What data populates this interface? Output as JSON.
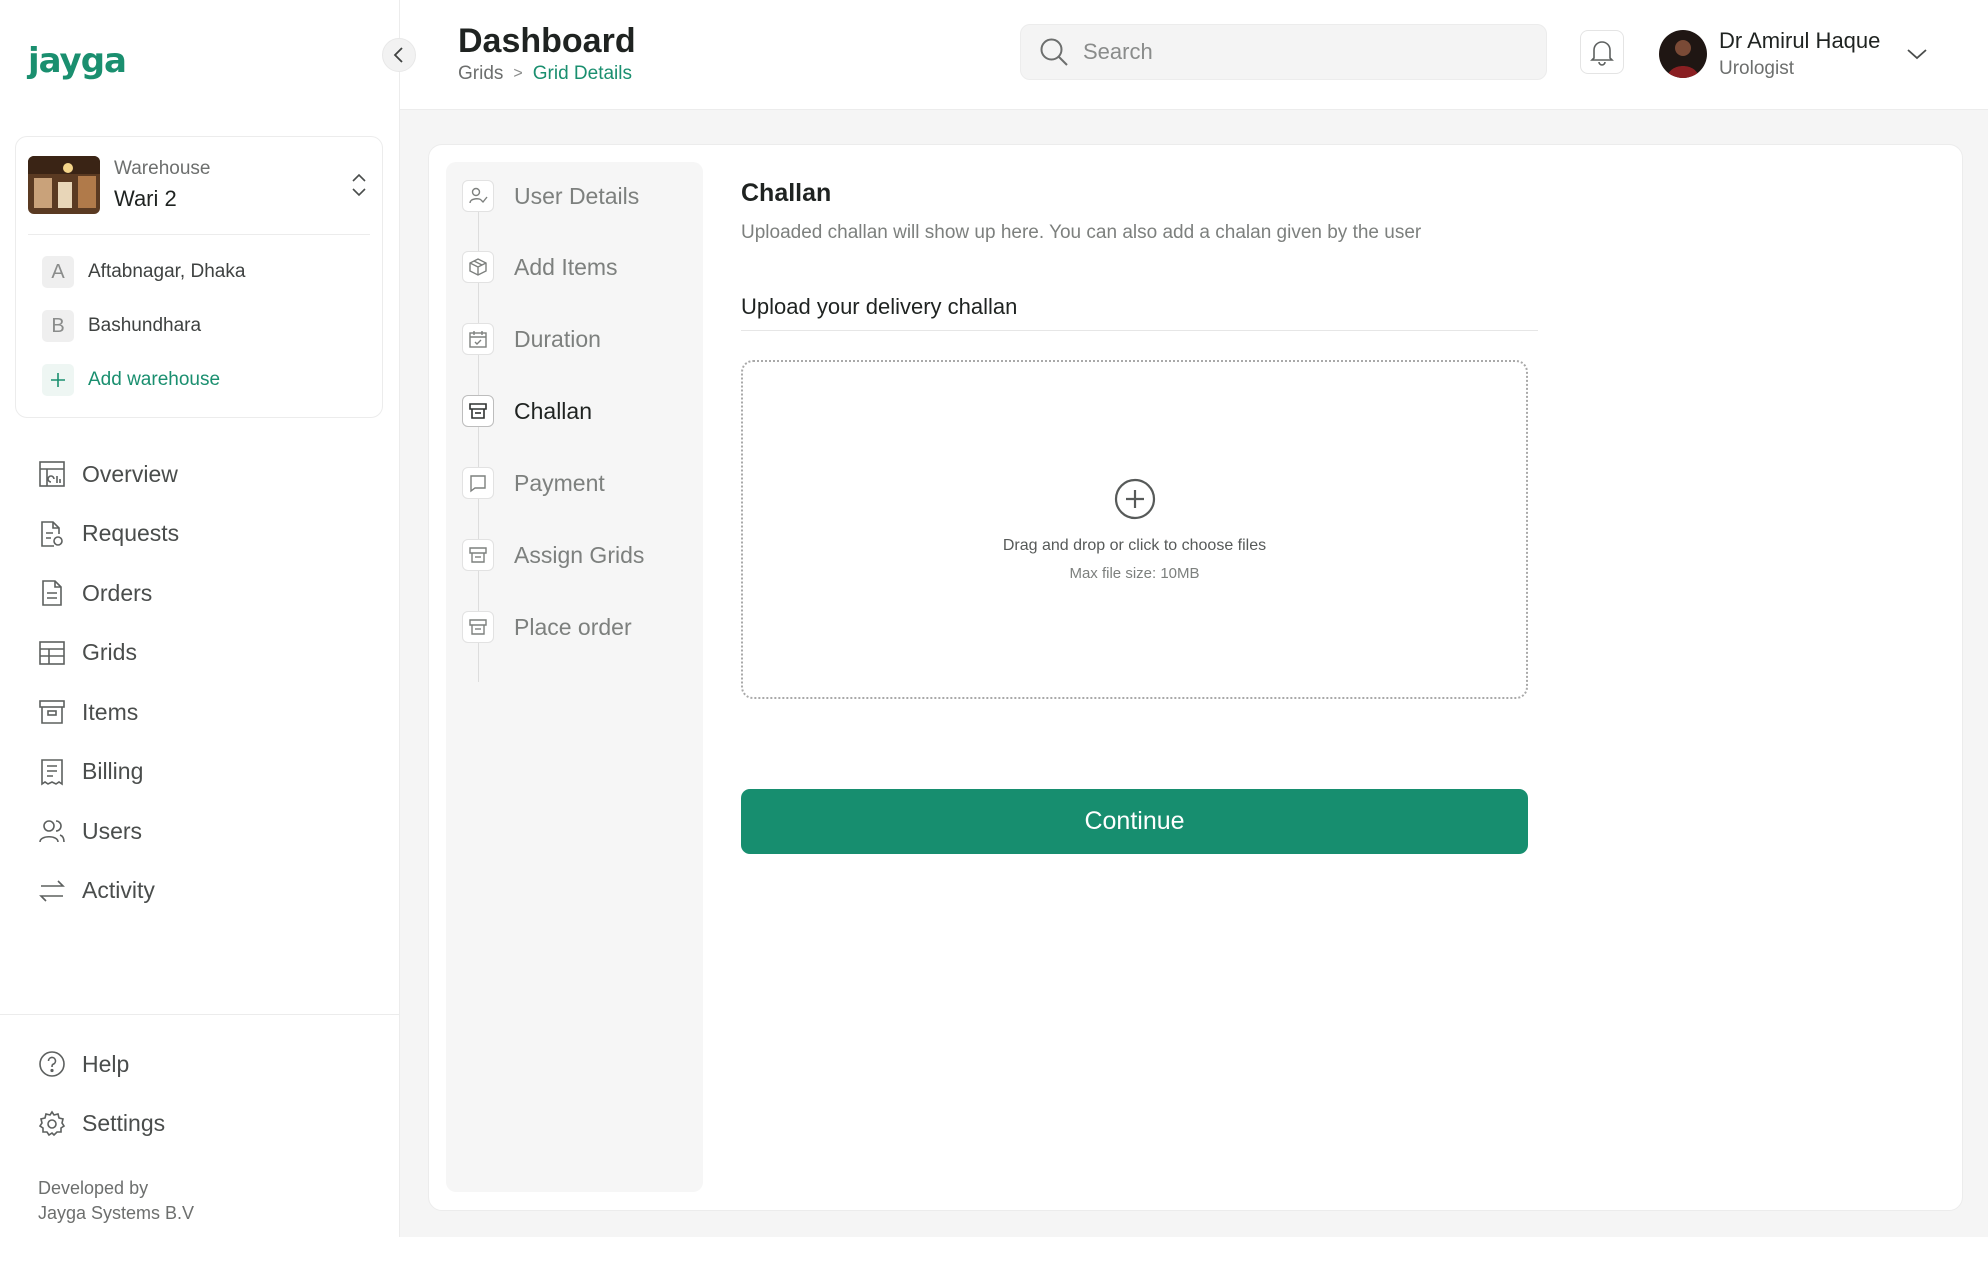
{
  "brand": {
    "logo_text": "jayga",
    "accent": "#1a8f6f"
  },
  "warehouse": {
    "caption": "Warehouse",
    "name": "Wari 2",
    "items": [
      {
        "letter": "A",
        "label": "Aftabnagar, Dhaka"
      },
      {
        "letter": "B",
        "label": "Bashundhara"
      }
    ],
    "add_label": "Add warehouse"
  },
  "nav": {
    "items": [
      {
        "label": "Overview",
        "icon": "overview-icon"
      },
      {
        "label": "Requests",
        "icon": "requests-icon"
      },
      {
        "label": "Orders",
        "icon": "orders-icon"
      },
      {
        "label": "Grids",
        "icon": "grids-icon"
      },
      {
        "label": "Items",
        "icon": "items-icon"
      },
      {
        "label": "Billing",
        "icon": "billing-icon"
      },
      {
        "label": "Users",
        "icon": "users-icon"
      },
      {
        "label": "Activity",
        "icon": "activity-icon"
      }
    ],
    "bottom": [
      {
        "label": "Help",
        "icon": "help-icon"
      },
      {
        "label": "Settings",
        "icon": "gear-icon"
      }
    ]
  },
  "footer": {
    "line1": "Developed by",
    "line2": "Jayga Systems B.V"
  },
  "header": {
    "title": "Dashboard",
    "breadcrumb": [
      "Grids",
      "Grid Details"
    ],
    "search_placeholder": "Search",
    "user": {
      "name": "Dr Amirul Haque",
      "role": "Urologist"
    }
  },
  "steps": [
    {
      "label": "User Details",
      "icon": "user-check-icon",
      "active": false
    },
    {
      "label": "Add Items",
      "icon": "box-icon",
      "active": false
    },
    {
      "label": "Duration",
      "icon": "calendar-icon",
      "active": false
    },
    {
      "label": "Challan",
      "icon": "store-icon",
      "active": true
    },
    {
      "label": "Payment",
      "icon": "payment-icon",
      "active": false
    },
    {
      "label": "Assign Grids",
      "icon": "store-icon",
      "active": false
    },
    {
      "label": "Place order",
      "icon": "store-icon",
      "active": false
    }
  ],
  "challan": {
    "title": "Challan",
    "description": "Uploaded challan will show up here. You can also add a chalan given by the user",
    "upload_title": "Upload your delivery challan",
    "dropzone_text": "Drag and drop or click to choose files",
    "dropzone_sub": "Max file size: 10MB",
    "continue_label": "Continue"
  }
}
